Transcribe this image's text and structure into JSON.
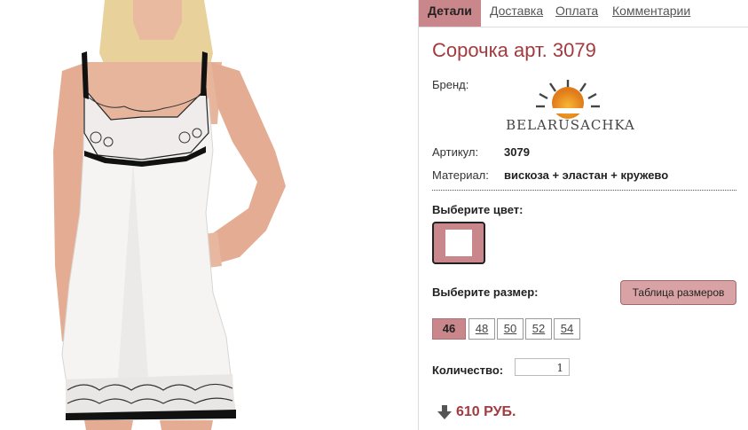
{
  "tabs": [
    {
      "label": "Детали",
      "active": true
    },
    {
      "label": "Доставка",
      "active": false
    },
    {
      "label": "Оплата",
      "active": false
    },
    {
      "label": "Комментарии",
      "active": false
    }
  ],
  "product": {
    "title": "Сорочка арт. 3079",
    "brand_label": "Бренд:",
    "brand_logo_text": "BELARUSACHKA",
    "article_label": "Артикул:",
    "article_value": "3079",
    "material_label": "Материал:",
    "material_value": "вискоза + эластан + кружево"
  },
  "color_section": {
    "label": "Выберите цвет:",
    "selected_color": "#ffffff"
  },
  "size_section": {
    "label": "Выберите размер:",
    "size_chart_button": "Таблица размеров",
    "sizes": [
      "46",
      "48",
      "50",
      "52",
      "54"
    ],
    "selected": "46"
  },
  "quantity": {
    "label": "Количество:",
    "value": "1"
  },
  "price": {
    "text": "610 РУБ."
  },
  "colors": {
    "accent": "#c9878b",
    "title": "#a23b40"
  }
}
